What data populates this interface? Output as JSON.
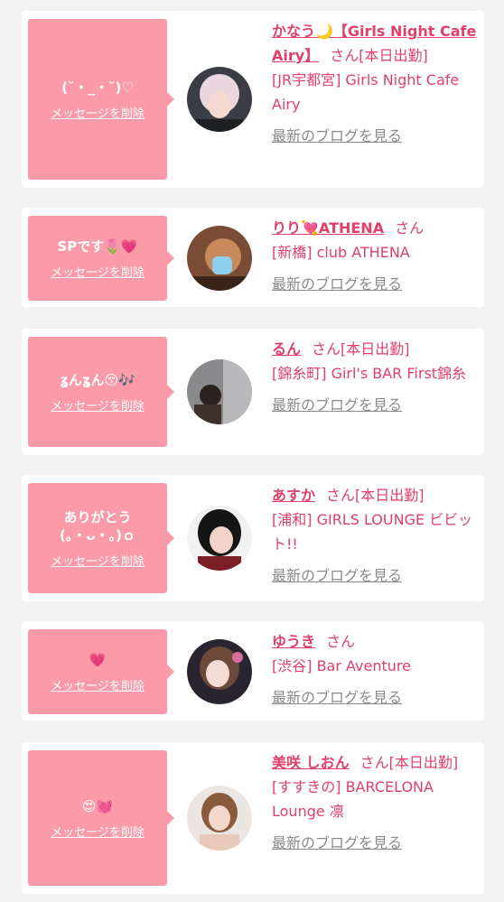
{
  "colors": {
    "bubble": "#fb9aa9",
    "accent": "#e0406a",
    "muted": "#8a8a8a",
    "card": "#ffffff",
    "page": "#f2f2f2"
  },
  "delete_label": "メッセージを削除",
  "blog_label": "最新のブログを見る",
  "honorific": "さん",
  "entries": [
    {
      "message": "(˘・_・˘)♡",
      "name": "かなう🌙【Girls Night Cafe Airy】",
      "status": "[本日出勤]",
      "shop": "[JR宇都宮] Girls Night Cafe Airy",
      "avatar_icon": "avatar-photo"
    },
    {
      "message": "SPです🌷💗",
      "name": "りり💘ATHENA",
      "status": "",
      "shop": "[新橋] club ATHENA",
      "avatar_icon": "avatar-photo"
    },
    {
      "message": "ʓんʓん😚🎶",
      "name": "るん",
      "status": "[本日出勤]",
      "shop": "[錦糸町] Girl's BAR First錦糸",
      "avatar_icon": "avatar-photo"
    },
    {
      "message": "ありがとう\n(｡・ᴗ・｡)ｏ",
      "name": "あすか",
      "status": "[本日出勤]",
      "shop": "[浦和] GIRLS LOUNGE ビビット!!",
      "avatar_icon": "avatar-photo"
    },
    {
      "message": "💗",
      "name": "ゆうき",
      "status": "",
      "shop": "[渋谷] Bar Aventure",
      "avatar_icon": "avatar-photo"
    },
    {
      "message": "😍💓",
      "name": "美咲 しおん",
      "status": "[本日出勤]",
      "shop": "[すすきの] BARCELONA Lounge 凛",
      "avatar_icon": "avatar-photo"
    }
  ]
}
